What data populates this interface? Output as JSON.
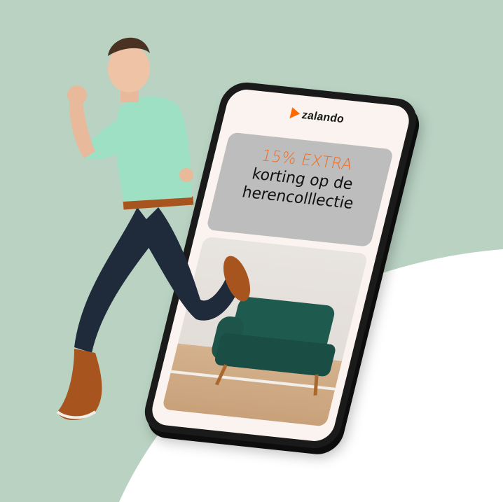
{
  "brand": {
    "name": "zalando",
    "logo_icon": "zalando-play-logo-icon",
    "logo_color": "#ff6900"
  },
  "promo": {
    "line1": "15% EXTRA",
    "line2": "korting op de",
    "line3": "herencolllectie",
    "accent_color": "#f06a21"
  },
  "colors": {
    "background": "#b9d2c2",
    "curve": "#ffffff",
    "promo_panel": "#bdbdbd"
  }
}
